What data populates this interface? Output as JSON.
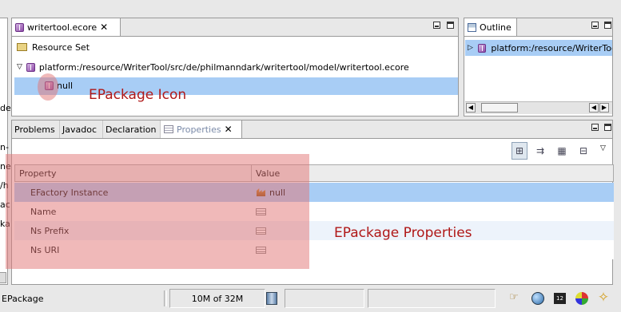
{
  "editor": {
    "tab_label": "writertool.ecore",
    "resource_set_label": "Resource Set",
    "resource_path": "platform:/resource/WriterTool/src/de/philmanndark/writertool/model/writertool.ecore",
    "package_label": "null"
  },
  "left_edge_text": [
    "de",
    "n-",
    "ne",
    "/h",
    "ac",
    "ka"
  ],
  "outline": {
    "tab_label": "Outline",
    "item_label": "platform:/resource/WriterTool"
  },
  "bottom": {
    "tabs": [
      "Problems",
      "Javadoc",
      "Declaration",
      "Properties"
    ],
    "active_tab": "Properties",
    "columns": [
      "Property",
      "Value"
    ],
    "rows": [
      {
        "property": "EFactory Instance",
        "value": "null"
      },
      {
        "property": "Name",
        "value": ""
      },
      {
        "property": "Ns Prefix",
        "value": ""
      },
      {
        "property": "Ns URI",
        "value": ""
      }
    ]
  },
  "annotations": {
    "icon_note": "EPackage Icon",
    "properties_note": "EPackage Properties"
  },
  "status": {
    "selection": "EPackage",
    "heap": "10M of 32M"
  },
  "colors": {
    "selection": "#a8cdf5",
    "highlight_overlay": "rgba(226, 116, 116, 0.5)",
    "annotation_text": "#b01818"
  }
}
